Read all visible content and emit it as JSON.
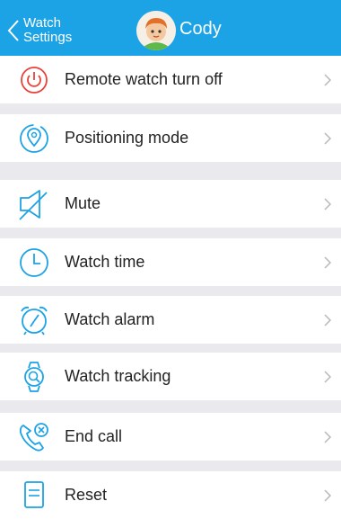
{
  "header": {
    "back_line1": "Watch",
    "back_line2": "Settings",
    "name": "Cody"
  },
  "menu": {
    "items": [
      {
        "label": "Remote watch turn off",
        "icon": "power-icon"
      },
      {
        "label": "Positioning mode",
        "icon": "location-pin-icon"
      },
      {
        "label": "Mute",
        "icon": "mute-speaker-icon"
      },
      {
        "label": "Watch time",
        "icon": "clock-icon"
      },
      {
        "label": "Watch alarm",
        "icon": "alarm-clock-icon"
      },
      {
        "label": "Watch tracking",
        "icon": "watch-search-icon"
      },
      {
        "label": "End call",
        "icon": "end-call-icon"
      },
      {
        "label": "Reset",
        "icon": "reset-document-icon"
      }
    ]
  },
  "colors": {
    "header_bg": "#1ba3e6",
    "icon_blue": "#1ba3e6",
    "power_red": "#e8423a",
    "divider_gray": "#e9e9ee"
  }
}
